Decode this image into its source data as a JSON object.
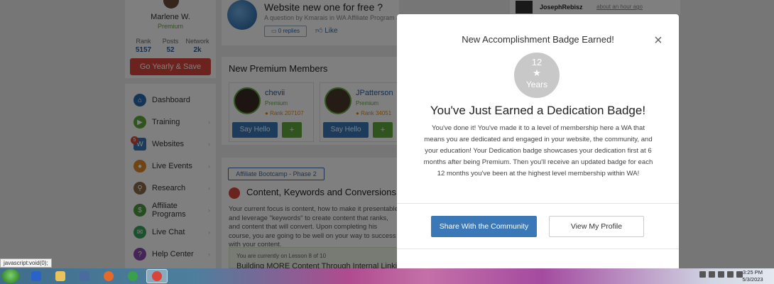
{
  "profile": {
    "name": "Marlene W.",
    "tier": "Premium",
    "stats": [
      {
        "label": "Rank",
        "value": "5157"
      },
      {
        "label": "Posts",
        "value": "52"
      },
      {
        "label": "Network",
        "value": "2k"
      }
    ],
    "cta_label": "Go Yearly & Save"
  },
  "nav": {
    "items": [
      {
        "label": "Dashboard",
        "icon": "home-icon",
        "color": "#2a6bb0"
      },
      {
        "label": "Training",
        "icon": "play-icon",
        "color": "#5fa83a"
      },
      {
        "label": "Websites",
        "icon": "websites-icon",
        "color": "#3a78b8",
        "badge": "5"
      },
      {
        "label": "Live Events",
        "icon": "live-events-icon",
        "color": "#e08a2a"
      },
      {
        "label": "Research",
        "icon": "research-icon",
        "color": "#8a6a4a"
      },
      {
        "label": "Affiliate Programs",
        "icon": "affiliate-icon",
        "color": "#4a9a3a"
      },
      {
        "label": "Live Chat",
        "icon": "chat-icon",
        "color": "#3aa05a"
      },
      {
        "label": "Help Center",
        "icon": "help-icon",
        "color": "#8a4ab0"
      }
    ]
  },
  "question": {
    "title": "Website new one for free ?",
    "subtitle": "A question by Kmarais in WA Affiliate Program ab...",
    "replies_label": "0 replies",
    "like_label": "Like"
  },
  "members": {
    "title": "New Premium Members",
    "list": [
      {
        "name": "chevii",
        "tier": "Premium",
        "rank": "Rank 207107"
      },
      {
        "name": "JPatterson",
        "tier": "Premium",
        "rank": "Rank 34051"
      }
    ],
    "say_hello_label": "Say Hello"
  },
  "course": {
    "bootcamp_label": "Affiliate Bootcamp - Phase 2",
    "title": "Content, Keywords and Conversions",
    "description": "Your current focus is content, how to make it presentable and leverage \"keywords\" to create content that ranks, and content that will convert. Upon completing his course, you are going to be well on your way to success with your content.",
    "lesson_text": "You are currently on Lesson 8 of 10",
    "lesson_title": "Building MORE Content Through Internal Linking"
  },
  "activity": {
    "name": "JosephRebisz",
    "time": "about an hour ago"
  },
  "modal": {
    "title": "New Accomplishment Badge Earned!",
    "close_symbol": "×",
    "badge_number": "12",
    "badge_star": "★",
    "badge_unit": "Years",
    "headline": "You've Just Earned a Dedication Badge!",
    "body": "You've done it! You've made it to a level of membership here a WA that means you are dedicated and engaged in your website, the community, and your education! Your Dedication badge showcases your dedication first at 6 months after being Premium. Then you'll receive an updated badge for each 12 months you've been at the highest level membership within WA!",
    "share_label": "Share With the Community",
    "profile_label": "View My Profile"
  },
  "statusbar": {
    "text": "javascript:void(0);"
  },
  "taskbar": {
    "apps": [
      {
        "name": "media-player-icon",
        "color": "#2a62c9"
      },
      {
        "name": "folder-icon",
        "color": "#e8c45a"
      },
      {
        "name": "video-icon",
        "color": "#4a6aa0"
      },
      {
        "name": "firefox-icon",
        "color": "#e4692a"
      },
      {
        "name": "chrome-icon",
        "color": "#3aa04a"
      },
      {
        "name": "chrome-active-icon",
        "color": "#d9443a"
      }
    ],
    "time": "3:25 PM",
    "date": "5/3/2023"
  }
}
